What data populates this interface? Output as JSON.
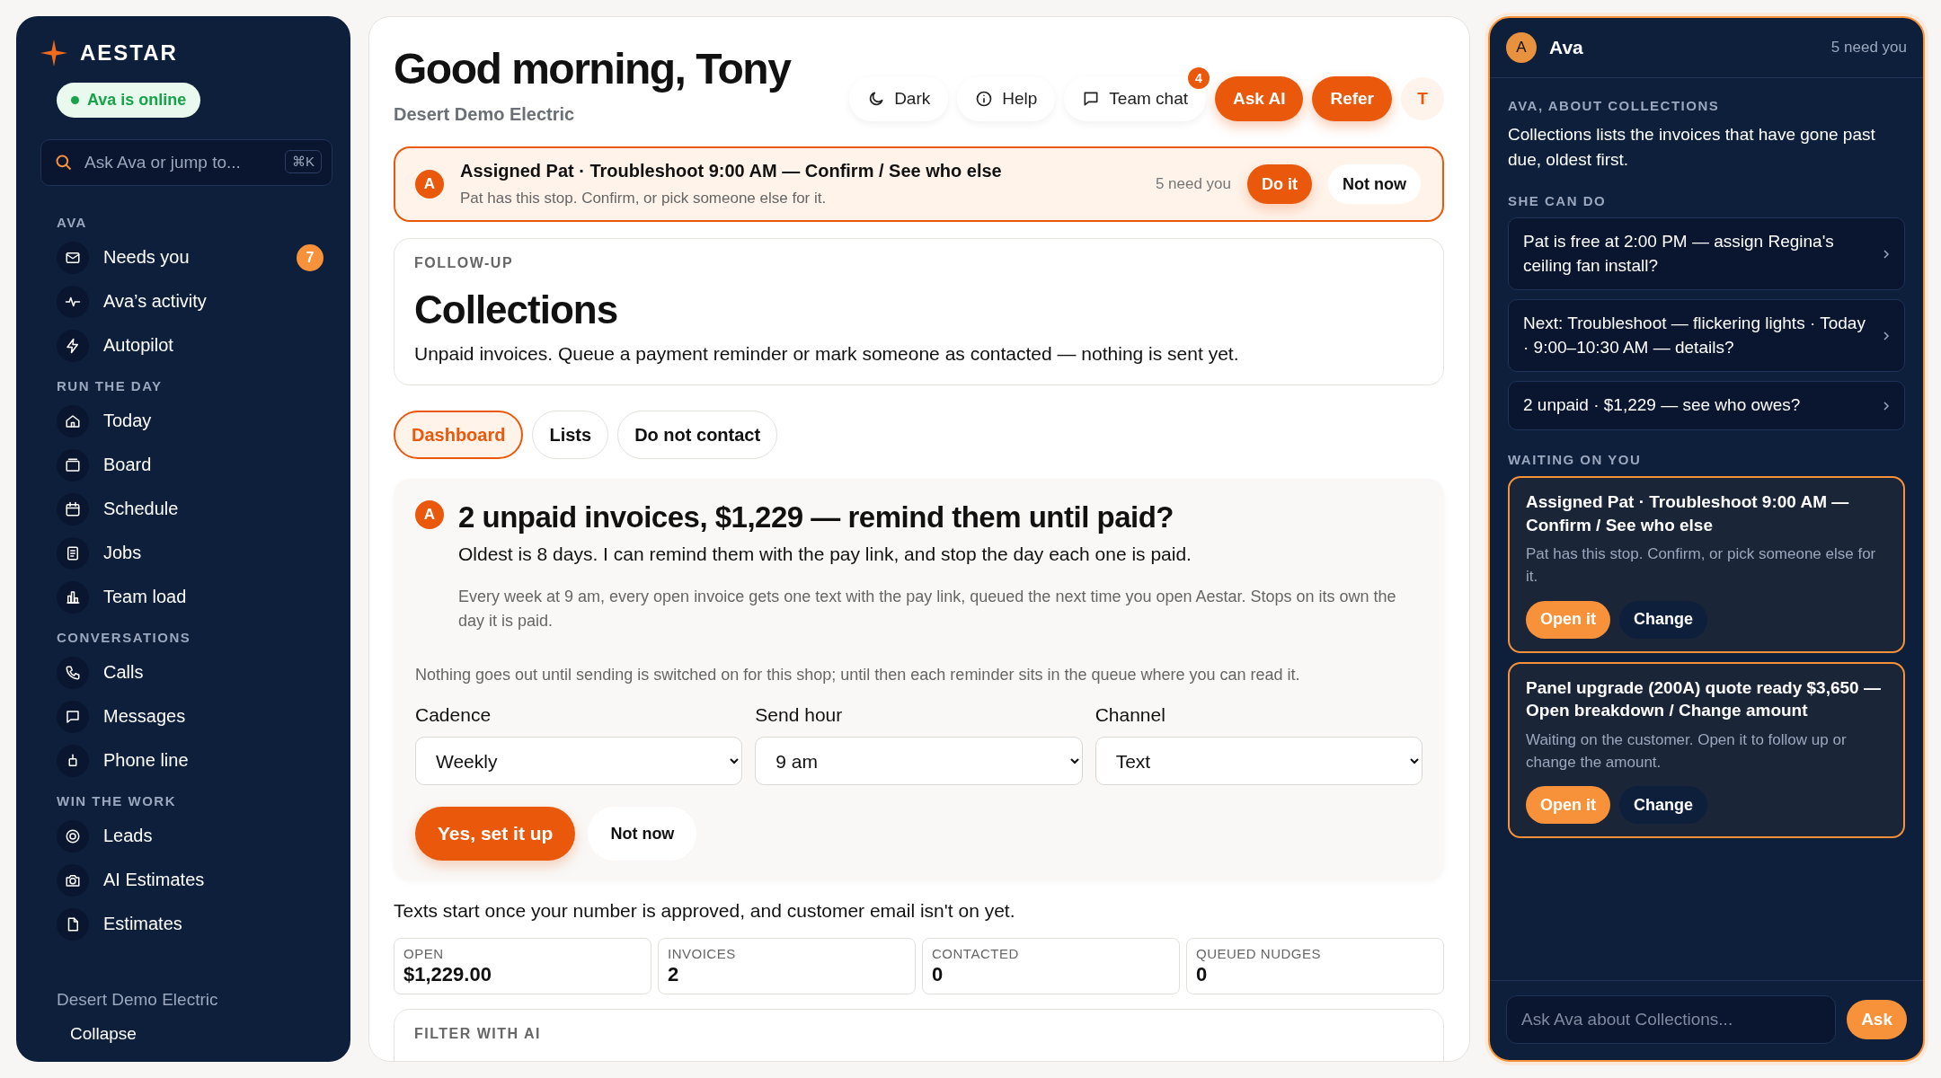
{
  "sidebar": {
    "brand": "AESTAR",
    "status": "Ava is online",
    "search": {
      "placeholder": "Ask Ava or jump to...",
      "shortcut": "⌘K"
    },
    "sections": [
      {
        "title": "AVA",
        "items": [
          {
            "label": "Needs you",
            "badge": "7"
          },
          {
            "label": "Ava’s activity"
          },
          {
            "label": "Autopilot"
          }
        ]
      },
      {
        "title": "RUN THE DAY",
        "items": [
          {
            "label": "Today"
          },
          {
            "label": "Board"
          },
          {
            "label": "Schedule"
          },
          {
            "label": "Jobs"
          },
          {
            "label": "Team load"
          }
        ]
      },
      {
        "title": "CONVERSATIONS",
        "items": [
          {
            "label": "Calls"
          },
          {
            "label": "Messages"
          },
          {
            "label": "Phone line"
          }
        ]
      },
      {
        "title": "WIN THE WORK",
        "items": [
          {
            "label": "Leads"
          },
          {
            "label": "AI Estimates"
          },
          {
            "label": "Estimates"
          }
        ]
      }
    ],
    "footer": "Desert Demo Electric",
    "collapse": "Collapse"
  },
  "header": {
    "title": "Good morning, Tony",
    "subtitle": "Desert Demo Electric",
    "actions": [
      {
        "label": "Dark",
        "kind": "plain"
      },
      {
        "label": "Help",
        "kind": "plain"
      },
      {
        "label": "Team chat",
        "kind": "plain",
        "badge": "4"
      },
      {
        "label": "Ask AI",
        "kind": "primary"
      },
      {
        "label": "Refer",
        "kind": "primary"
      }
    ],
    "avatar": "T"
  },
  "banner": {
    "avatar": "A",
    "title": "Assigned Pat · Troubleshoot 9:00 AM — Confirm / See who else",
    "text": "Pat has this stop. Confirm, or pick someone else for it.",
    "count": "5 need you",
    "buttons": [
      {
        "label": "Do it",
        "kind": "primary"
      },
      {
        "label": "Not now",
        "kind": "plain"
      }
    ]
  },
  "page": {
    "eyebrow": "FOLLOW-UP",
    "title": "Collections",
    "text": "Unpaid invoices. Queue a payment reminder or mark someone as contacted — nothing is sent yet."
  },
  "tabs": [
    {
      "label": "Dashboard",
      "selected": true
    },
    {
      "label": "Lists",
      "selected": false
    },
    {
      "label": "Do not contact",
      "selected": false
    }
  ],
  "suggestion": {
    "avatar": "A",
    "title": "2 unpaid invoices, $1,229 — remind them until paid?",
    "subtitle": "Oldest is 8 days. I can remind them with the pay link, and stop the day each one is paid.",
    "detail": "Every week at 9 am, every open invoice gets one text with the pay link, queued the next time you open Aestar. Stops on its own the day it is paid.",
    "note": "Nothing goes out until sending is switched on for this shop; until then each reminder sits in the queue where you can read it.",
    "fields": [
      {
        "label": "Cadence",
        "value": "Weekly"
      },
      {
        "label": "Send hour",
        "value": "9 am"
      },
      {
        "label": "Channel",
        "value": "Text"
      }
    ],
    "buttons": [
      {
        "label": "Yes, set it up",
        "kind": "primary"
      },
      {
        "label": "Not now",
        "kind": "plain"
      }
    ]
  },
  "notice": "Texts start once your number is approved, and customer email isn't on yet.",
  "stats": [
    {
      "label": "OPEN",
      "value": "$1,229.00"
    },
    {
      "label": "INVOICES",
      "value": "2"
    },
    {
      "label": "CONTACTED",
      "value": "0"
    },
    {
      "label": "QUEUED NUDGES",
      "value": "0"
    }
  ],
  "filter": {
    "title": "FILTER WITH AI"
  },
  "assistant": {
    "avatar": "A",
    "name": "Ava",
    "count": "5 need you",
    "about_title": "AVA, ABOUT COLLECTIONS",
    "about": "Collections lists the invoices that have gone past due, oldest first.",
    "can_do_title": "SHE CAN DO",
    "can_do": [
      "Pat is free at 2:00 PM — assign Regina's ceiling fan install?",
      "Next: Troubleshoot — flickering lights · Today · 9:00–10:30 AM — details?",
      "2 unpaid · $1,229 — see who owes?"
    ],
    "waiting_title": "WAITING ON YOU",
    "waiting": [
      {
        "title": "Assigned Pat · Troubleshoot 9:00 AM — Confirm / See who else",
        "text": "Pat has this stop. Confirm, or pick someone else for it.",
        "buttons": [
          {
            "label": "Open it",
            "kind": "primary"
          },
          {
            "label": "Change",
            "kind": "plain"
          }
        ]
      },
      {
        "title": "Panel upgrade (200A) quote ready $3,650 — Open breakdown / Change amount",
        "text": "Waiting on the customer. Open it to follow up or change the amount.",
        "buttons": [
          {
            "label": "Open it",
            "kind": "primary"
          },
          {
            "label": "Change",
            "kind": "plain"
          }
        ]
      }
    ],
    "input": {
      "placeholder": "Ask Ava about Collections..."
    },
    "ask": "Ask"
  }
}
